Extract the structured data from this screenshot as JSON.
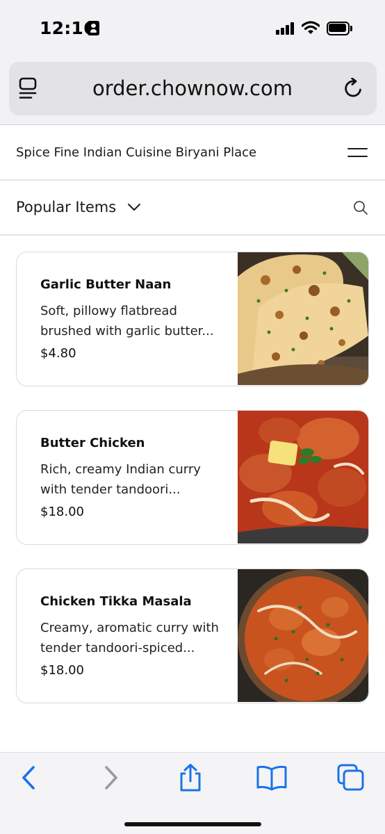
{
  "status_bar": {
    "time": "12:16"
  },
  "browser": {
    "url": "order.chownow.com"
  },
  "header": {
    "restaurant_name": "Spice Fine Indian Cuisine Biryani Place"
  },
  "category": {
    "label": "Popular Items"
  },
  "items": [
    {
      "name": "Garlic Butter Naan",
      "description": "Soft, pillowy flatbread brushed with garlic butter...",
      "price": "$4.80",
      "image": "naan-photo"
    },
    {
      "name": "Butter Chicken",
      "description": "Rich, creamy Indian curry with tender tandoori...",
      "price": "$18.00",
      "image": "butter-chicken-photo"
    },
    {
      "name": "Chicken Tikka Masala",
      "description": "Creamy, aromatic curry with tender tandoori-spiced...",
      "price": "$18.00",
      "image": "tikka-masala-photo"
    }
  ],
  "toolbar": {
    "icons": [
      "back-icon",
      "forward-icon",
      "share-icon",
      "bookmarks-icon",
      "tabs-icon"
    ],
    "accent_color": "#1a73e8",
    "disabled_color": "#9a9a9f"
  }
}
